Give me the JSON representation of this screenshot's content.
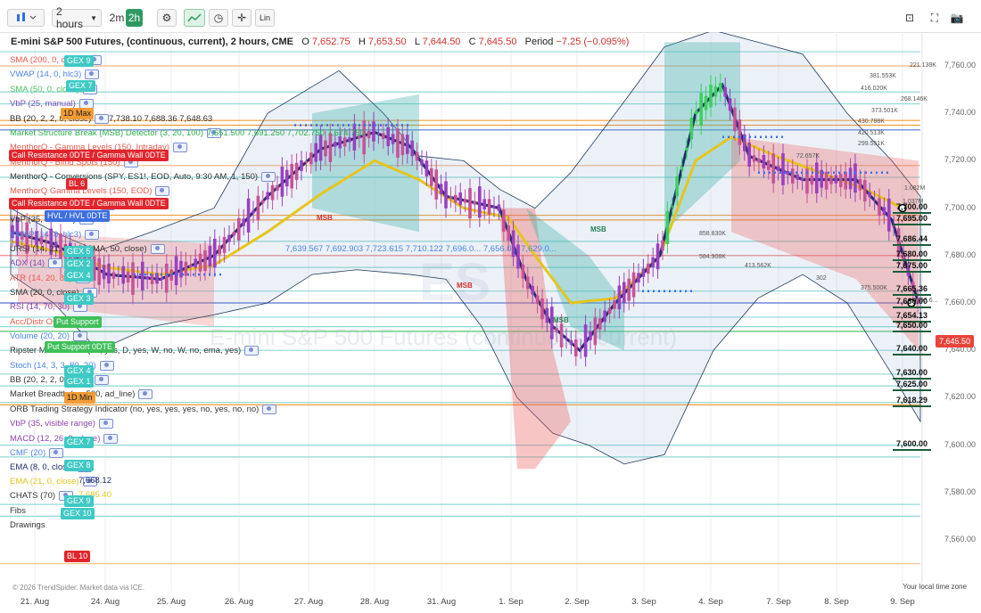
{
  "toolbar": {
    "interval": "2 hours",
    "interval_2m": "2m",
    "interval_2h": "2h",
    "lin": "Lin"
  },
  "title": {
    "symbol": "E-mini S&P 500 Futures, (continuous, current), 2 hours, CME",
    "o_label": "O",
    "o": "7,652.75",
    "h_label": "H",
    "h": "7,653.50",
    "l_label": "L",
    "l": "7,644.50",
    "c_label": "C",
    "c": "7,645.50",
    "period_label": "Period",
    "period": "−7.25 (−0.095%)"
  },
  "indicators": [
    {
      "text": "SMA (200, 0, close)",
      "color": "#e8594c"
    },
    {
      "text": "VWAP (14, 0, hlc3)",
      "color": "#4a86e8"
    },
    {
      "text": "SMA (50, 0, close)",
      "color": "#4fc462"
    },
    {
      "text": "VbP (25, manual)",
      "color": "#7a4fb8"
    },
    {
      "text": "BB (20, 2, 2, 0, close)",
      "color": "#333"
    },
    {
      "text": "Market Structure Break (MSB) Detector (3, 20, 100)",
      "color": "#2ab24a"
    },
    {
      "text": "MenthorQ - Gamma Levels (150, Intraday)",
      "color": "#e8594c"
    },
    {
      "text": "MenthorQ - Blind Spots (150)",
      "color": "#e8594c"
    },
    {
      "text": "MenthorQ - Conversions (SPY, ES1!, EOD, Auto, 9:30 AM, 1, 150)",
      "color": "#333"
    },
    {
      "text": "MenthorQ Gamma Levels (150, EOD)",
      "color": "#e8594c"
    },
    {
      "text": "Session Volume Profile",
      "color": "#333"
    },
    {
      "text": "VbP (35, manual)",
      "color": "#333"
    },
    {
      "text": "VWAP (14, 0, hlc3)",
      "color": "#4a86e8"
    },
    {
      "text": "URSI (14, 21, 20, 2, SMA, 50, close)",
      "color": "#333"
    },
    {
      "text": "ADX (14)",
      "color": "#7a4fb8"
    },
    {
      "text": "ATR (14, 20, 80)",
      "color": "#e8594c"
    },
    {
      "text": "SMA (20, 0, close)",
      "color": "#333"
    },
    {
      "text": "RSI (14, 70, 30)",
      "color": "#8e44ad"
    },
    {
      "text": "Acc/Distr Osc (14)",
      "color": "#e8594c"
    },
    {
      "text": "Volume (20, 20)",
      "color": "#4a86e8"
    },
    {
      "text": "Ripster MTF Clouds (50, yes, D, yes, W, no, W, no, ema, yes)",
      "color": "#333"
    },
    {
      "text": "Stoch (14, 3, 3, 80, 20)",
      "color": "#4a86e8"
    },
    {
      "text": "BB (20, 2, 2, 0, close)",
      "color": "#333"
    },
    {
      "text": "Market Breadth (spx500, ad_line)",
      "color": "#333"
    },
    {
      "text": "ORB Trading Strategy Indicator (no, yes, yes, yes, no, yes, no, no)",
      "color": "#333"
    },
    {
      "text": "VbP (35, visible range)",
      "color": "#8e44ad"
    },
    {
      "text": "MACD (12, 26, 9, close)",
      "color": "#8e44ad"
    },
    {
      "text": "CMF (20)",
      "color": "#4a86e8"
    },
    {
      "text": "EMA (8, 0, close)",
      "color": "#1f2d6b"
    },
    {
      "text": "EMA (21, 0, close)",
      "color": "#e6c51d"
    },
    {
      "text": "CHATS (70)",
      "color": "#333"
    },
    {
      "text": "Fibs",
      "color": "#333"
    },
    {
      "text": "Drawings",
      "color": "#333"
    }
  ],
  "indicator_values": {
    "bb_values": "7,738.10  7,688.36  7,648.63",
    "msb_values": "7,651.500  7,691.250  7,702.750  7,674.750",
    "vwap2_values": "7,639.567  7,692.903  7,723.615  7,710.122  7,696.0...  7,656.0...  7,629.0...",
    "ema8_value": "7,668.12",
    "ema21_value": "7,685.40"
  },
  "badges": [
    {
      "text": "GEX 9",
      "cls": "gex"
    },
    {
      "text": "GEX 7",
      "cls": "gex"
    },
    {
      "text": "1D Max",
      "cls": "orange"
    },
    {
      "text": "Call Resistance 0DTE / Gamma Wall 0DTE",
      "cls": "red"
    },
    {
      "text": "BL 6",
      "cls": "red"
    },
    {
      "text": "Call Resistance 0DTE / Gamma Wall 0DTE",
      "cls": "red"
    },
    {
      "text": "HVL / HVL 0DTE",
      "cls": "blue"
    },
    {
      "text": "GEX 5",
      "cls": "gex"
    },
    {
      "text": "GEX 2",
      "cls": "gex"
    },
    {
      "text": "GEX 4",
      "cls": "gex"
    },
    {
      "text": "GEX 3",
      "cls": "gex"
    },
    {
      "text": "Put Support",
      "cls": "green"
    },
    {
      "text": "Put Support 0DTE",
      "cls": "green"
    },
    {
      "text": "GEX 4",
      "cls": "gex"
    },
    {
      "text": "GEX 1",
      "cls": "gex"
    },
    {
      "text": "1D Min",
      "cls": "orange"
    },
    {
      "text": "GEX 7",
      "cls": "gex"
    },
    {
      "text": "GEX 8",
      "cls": "gex"
    },
    {
      "text": "GEX 9",
      "cls": "gex"
    },
    {
      "text": "GEX 10",
      "cls": "gex"
    },
    {
      "text": "BL 10",
      "cls": "red"
    }
  ],
  "price_axis": [
    "7,760.00",
    "7,740.00",
    "7,720.00",
    "7,700.00",
    "7,680.00",
    "7,660.00",
    "7,640.00",
    "7,620.00",
    "7,600.00",
    "7,580.00",
    "7,560.00"
  ],
  "level_labels": [
    "7,700.00",
    "7,695.00",
    "7,686.44",
    "7,680.00",
    "7,675.00",
    "7,665.36",
    "7,660.00",
    "7,654.13",
    "7,650.00",
    "7,640.00",
    "7,630.00",
    "7,625.00",
    "7,618.29",
    "7,600.00"
  ],
  "current_price": "7,645.50",
  "volume_labels": [
    "221.138K",
    "381.553K",
    "416.020K",
    "268.146K",
    "373.501K",
    "430.788K",
    "420.513K",
    "299.551K",
    "72.657K",
    "1.082M",
    "1.037M",
    "858.830K",
    "584.908K",
    "413.562K",
    "302",
    "375.500K",
    "298.6..."
  ],
  "dates": [
    "21. Aug",
    "24. Aug",
    "25. Aug",
    "26. Aug",
    "27. Aug",
    "28. Aug",
    "31. Aug",
    "1. Sep",
    "2. Sep",
    "3. Sep",
    "4. Sep",
    "7. Sep",
    "8. Sep",
    "9. Sep"
  ],
  "msb_labels": [
    "MSB",
    "MSB",
    "MSB",
    "MSB"
  ],
  "watermark": "E-mini S&P 500 Futures (continuous, current)",
  "watermark_big": "ES",
  "timezone": "Your local time zone",
  "copyright": "© 2026 TrendSpider. Market data via ICE.",
  "colors": {
    "gex": "#3ec9c4",
    "red": "#e0262c",
    "orange": "#f39c35",
    "green": "#3fbf5a",
    "ema8": "#1f2d6b",
    "ema21": "#e6c51d",
    "accent": "#2e9a62"
  }
}
